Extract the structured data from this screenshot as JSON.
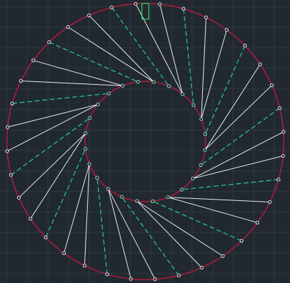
{
  "colors": {
    "background": "#212830",
    "grid": "#2e3740",
    "circle": "#b01c3a",
    "solid_line": "#eef0f2",
    "dashed_line": "#27c4a0",
    "node_stroke": "#e8ecef",
    "inner_node_stroke": "#7fe0cc",
    "marker": "#2fd16a"
  },
  "drawing": {
    "type": "cad-wireframe",
    "description_visible_text": "",
    "outer_node_count": 36,
    "inner_node_count": 24
  }
}
